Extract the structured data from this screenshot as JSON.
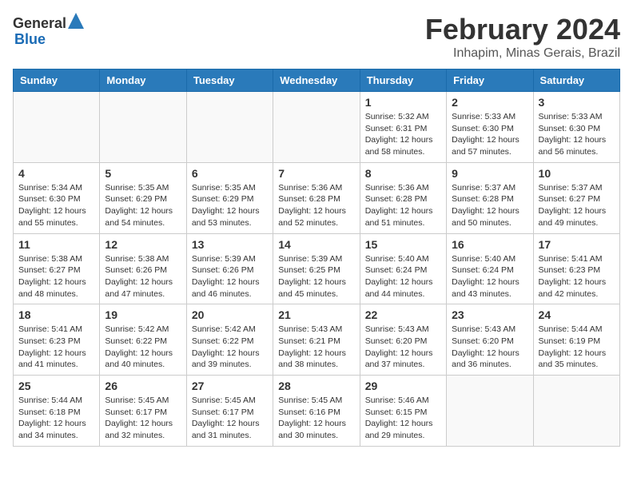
{
  "header": {
    "logo_general": "General",
    "logo_blue": "Blue",
    "month_year": "February 2024",
    "location": "Inhapim, Minas Gerais, Brazil"
  },
  "days_of_week": [
    "Sunday",
    "Monday",
    "Tuesday",
    "Wednesday",
    "Thursday",
    "Friday",
    "Saturday"
  ],
  "weeks": [
    [
      {
        "day": "",
        "info": ""
      },
      {
        "day": "",
        "info": ""
      },
      {
        "day": "",
        "info": ""
      },
      {
        "day": "",
        "info": ""
      },
      {
        "day": "1",
        "info": "Sunrise: 5:32 AM\nSunset: 6:31 PM\nDaylight: 12 hours\nand 58 minutes."
      },
      {
        "day": "2",
        "info": "Sunrise: 5:33 AM\nSunset: 6:30 PM\nDaylight: 12 hours\nand 57 minutes."
      },
      {
        "day": "3",
        "info": "Sunrise: 5:33 AM\nSunset: 6:30 PM\nDaylight: 12 hours\nand 56 minutes."
      }
    ],
    [
      {
        "day": "4",
        "info": "Sunrise: 5:34 AM\nSunset: 6:30 PM\nDaylight: 12 hours\nand 55 minutes."
      },
      {
        "day": "5",
        "info": "Sunrise: 5:35 AM\nSunset: 6:29 PM\nDaylight: 12 hours\nand 54 minutes."
      },
      {
        "day": "6",
        "info": "Sunrise: 5:35 AM\nSunset: 6:29 PM\nDaylight: 12 hours\nand 53 minutes."
      },
      {
        "day": "7",
        "info": "Sunrise: 5:36 AM\nSunset: 6:28 PM\nDaylight: 12 hours\nand 52 minutes."
      },
      {
        "day": "8",
        "info": "Sunrise: 5:36 AM\nSunset: 6:28 PM\nDaylight: 12 hours\nand 51 minutes."
      },
      {
        "day": "9",
        "info": "Sunrise: 5:37 AM\nSunset: 6:28 PM\nDaylight: 12 hours\nand 50 minutes."
      },
      {
        "day": "10",
        "info": "Sunrise: 5:37 AM\nSunset: 6:27 PM\nDaylight: 12 hours\nand 49 minutes."
      }
    ],
    [
      {
        "day": "11",
        "info": "Sunrise: 5:38 AM\nSunset: 6:27 PM\nDaylight: 12 hours\nand 48 minutes."
      },
      {
        "day": "12",
        "info": "Sunrise: 5:38 AM\nSunset: 6:26 PM\nDaylight: 12 hours\nand 47 minutes."
      },
      {
        "day": "13",
        "info": "Sunrise: 5:39 AM\nSunset: 6:26 PM\nDaylight: 12 hours\nand 46 minutes."
      },
      {
        "day": "14",
        "info": "Sunrise: 5:39 AM\nSunset: 6:25 PM\nDaylight: 12 hours\nand 45 minutes."
      },
      {
        "day": "15",
        "info": "Sunrise: 5:40 AM\nSunset: 6:24 PM\nDaylight: 12 hours\nand 44 minutes."
      },
      {
        "day": "16",
        "info": "Sunrise: 5:40 AM\nSunset: 6:24 PM\nDaylight: 12 hours\nand 43 minutes."
      },
      {
        "day": "17",
        "info": "Sunrise: 5:41 AM\nSunset: 6:23 PM\nDaylight: 12 hours\nand 42 minutes."
      }
    ],
    [
      {
        "day": "18",
        "info": "Sunrise: 5:41 AM\nSunset: 6:23 PM\nDaylight: 12 hours\nand 41 minutes."
      },
      {
        "day": "19",
        "info": "Sunrise: 5:42 AM\nSunset: 6:22 PM\nDaylight: 12 hours\nand 40 minutes."
      },
      {
        "day": "20",
        "info": "Sunrise: 5:42 AM\nSunset: 6:22 PM\nDaylight: 12 hours\nand 39 minutes."
      },
      {
        "day": "21",
        "info": "Sunrise: 5:43 AM\nSunset: 6:21 PM\nDaylight: 12 hours\nand 38 minutes."
      },
      {
        "day": "22",
        "info": "Sunrise: 5:43 AM\nSunset: 6:20 PM\nDaylight: 12 hours\nand 37 minutes."
      },
      {
        "day": "23",
        "info": "Sunrise: 5:43 AM\nSunset: 6:20 PM\nDaylight: 12 hours\nand 36 minutes."
      },
      {
        "day": "24",
        "info": "Sunrise: 5:44 AM\nSunset: 6:19 PM\nDaylight: 12 hours\nand 35 minutes."
      }
    ],
    [
      {
        "day": "25",
        "info": "Sunrise: 5:44 AM\nSunset: 6:18 PM\nDaylight: 12 hours\nand 34 minutes."
      },
      {
        "day": "26",
        "info": "Sunrise: 5:45 AM\nSunset: 6:17 PM\nDaylight: 12 hours\nand 32 minutes."
      },
      {
        "day": "27",
        "info": "Sunrise: 5:45 AM\nSunset: 6:17 PM\nDaylight: 12 hours\nand 31 minutes."
      },
      {
        "day": "28",
        "info": "Sunrise: 5:45 AM\nSunset: 6:16 PM\nDaylight: 12 hours\nand 30 minutes."
      },
      {
        "day": "29",
        "info": "Sunrise: 5:46 AM\nSunset: 6:15 PM\nDaylight: 12 hours\nand 29 minutes."
      },
      {
        "day": "",
        "info": ""
      },
      {
        "day": "",
        "info": ""
      }
    ]
  ]
}
